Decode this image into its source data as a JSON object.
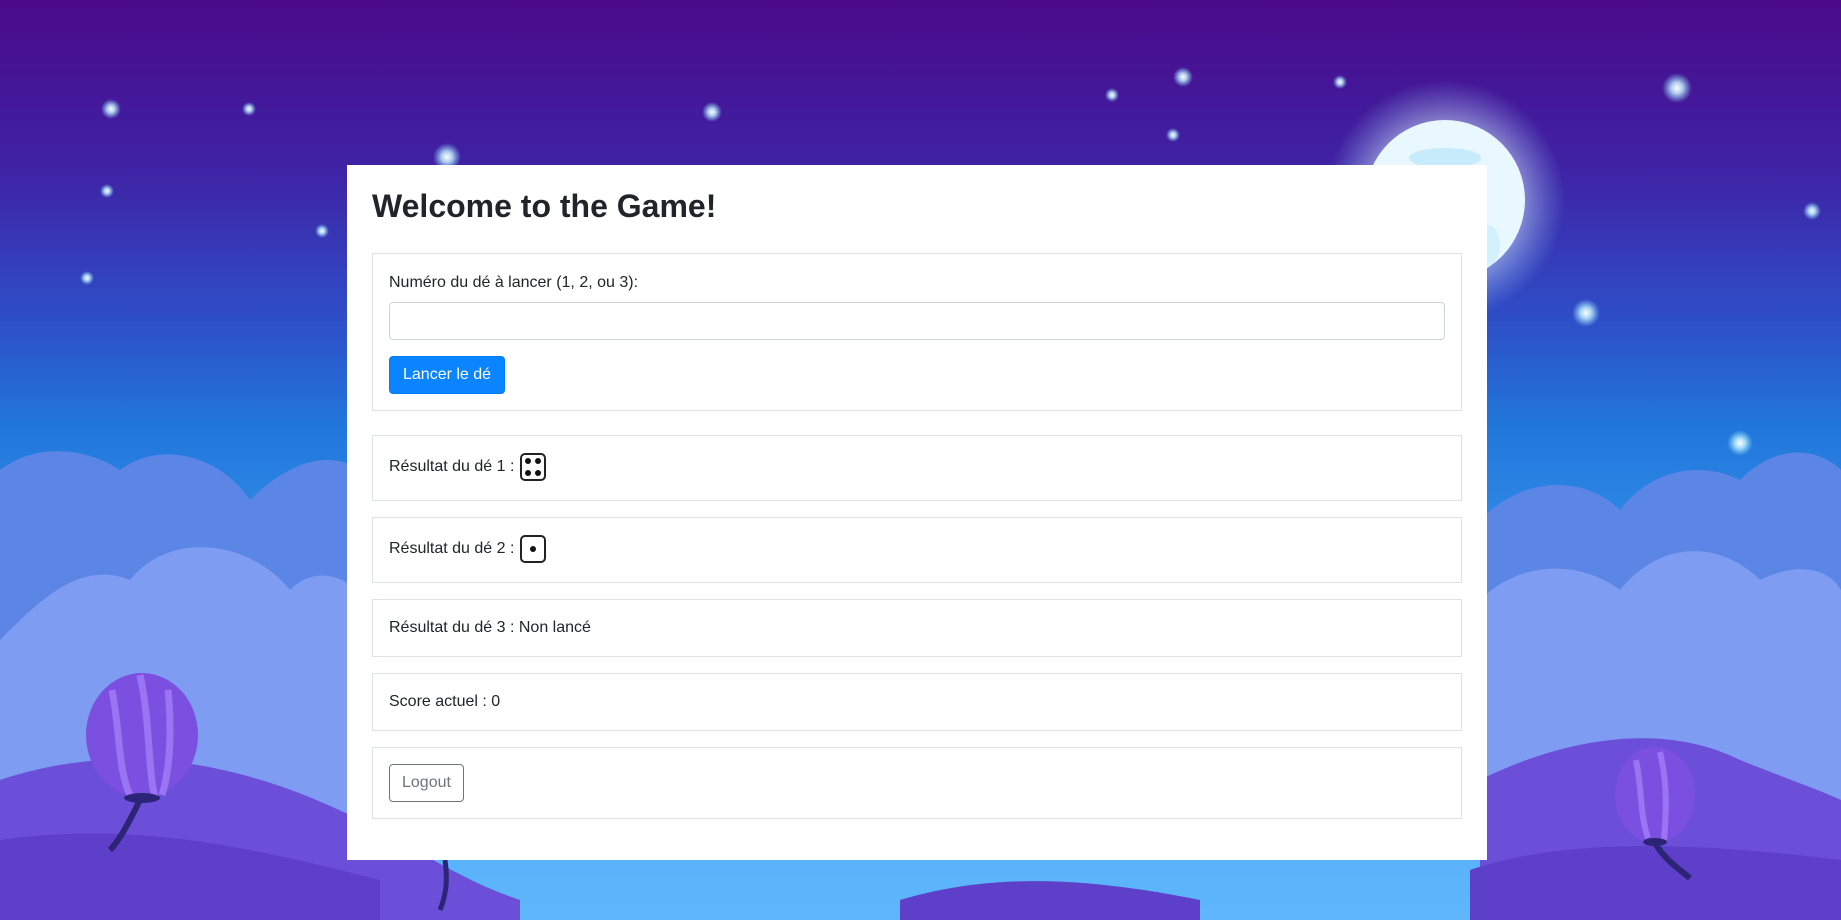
{
  "game": {
    "title": "Welcome to the Game!",
    "roll_form": {
      "label": "Numéro du dé à lancer (1, 2, ou 3):",
      "input_value": "",
      "input_placeholder": "",
      "button_label": "Lancer le dé"
    },
    "dice": [
      {
        "label": "Résultat du dé 1 :",
        "face": 4,
        "status": ""
      },
      {
        "label": "Résultat du dé 2 :",
        "face": 1,
        "status": ""
      },
      {
        "label": "Résultat du dé 3 :",
        "face": null,
        "status": "Non lancé"
      }
    ],
    "score": {
      "label": "Score actuel :",
      "value": "0"
    },
    "logout_label": "Logout"
  },
  "colors": {
    "primary": "#0a84ff",
    "secondary": "#6c757d",
    "sky_top": "#4a0a8a",
    "sky_bottom": "#5fb6fb"
  }
}
